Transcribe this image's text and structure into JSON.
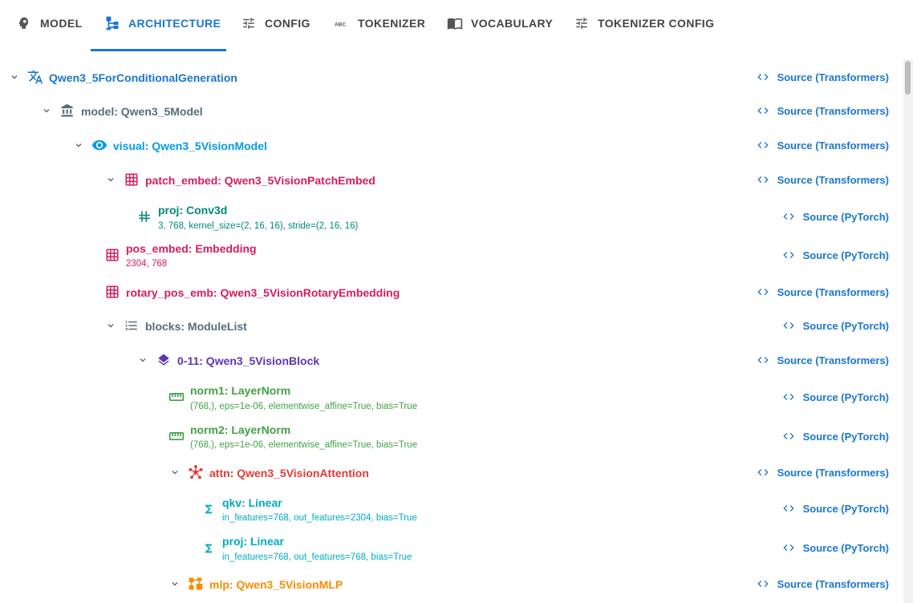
{
  "tabs": [
    {
      "label": "MODEL",
      "icon": "model-icon"
    },
    {
      "label": "ARCHITECTURE",
      "icon": "architecture-icon"
    },
    {
      "label": "CONFIG",
      "icon": "tune-icon"
    },
    {
      "label": "TOKENIZER",
      "icon": "abc-icon"
    },
    {
      "label": "VOCABULARY",
      "icon": "book-icon"
    },
    {
      "label": "TOKENIZER CONFIG",
      "icon": "tune-icon"
    }
  ],
  "active_tab": "ARCHITECTURE",
  "colors": {
    "accent": "#1976d2",
    "conditional_generation": "#1976d2",
    "model": "#546e7a",
    "visual": "#039be5",
    "patch_embed": "#d81b60",
    "conv": "#00897b",
    "module_list": "#546e7a",
    "block": "#5e35b1",
    "layer_norm": "#43a047",
    "attention": "#e53935",
    "linear": "#00acc1",
    "mlp": "#fb8c00"
  },
  "tree": [
    {
      "title": "Qwen3_5ForConditionalGeneration",
      "sub": "",
      "source": "Source (Transformers)",
      "icon": "translate-icon"
    },
    {
      "title": "model: Qwen3_5Model",
      "sub": "",
      "source": "Source (Transformers)",
      "icon": "bank-icon"
    },
    {
      "title": "visual: Qwen3_5VisionModel",
      "sub": "",
      "source": "Source (Transformers)",
      "icon": "eye-icon"
    },
    {
      "title": "patch_embed: Qwen3_5VisionPatchEmbed",
      "sub": "",
      "source": "Source (Transformers)",
      "icon": "grid-icon"
    },
    {
      "title": "proj: Conv3d",
      "sub": "3, 768, kernel_size=(2, 16, 16), stride=(2, 16, 16)",
      "source": "Source (PyTorch)",
      "icon": "hash-icon"
    },
    {
      "title": "pos_embed: Embedding",
      "sub": "2304, 768",
      "source": "Source (PyTorch)",
      "icon": "grid-icon"
    },
    {
      "title": "rotary_pos_emb: Qwen3_5VisionRotaryEmbedding",
      "sub": "",
      "source": "Source (Transformers)",
      "icon": "grid-icon"
    },
    {
      "title": "blocks: ModuleList",
      "sub": "",
      "source": "Source (PyTorch)",
      "icon": "list-icon"
    },
    {
      "title": "0-11: Qwen3_5VisionBlock",
      "sub": "",
      "source": "Source (Transformers)",
      "icon": "layers-icon"
    },
    {
      "title": "norm1: LayerNorm",
      "sub": "(768,), eps=1e-06, elementwise_affine=True, bias=True",
      "source": "Source (PyTorch)",
      "icon": "ruler-icon"
    },
    {
      "title": "norm2: LayerNorm",
      "sub": "(768,), eps=1e-06, elementwise_affine=True, bias=True",
      "source": "Source (PyTorch)",
      "icon": "ruler-icon"
    },
    {
      "title": "attn: Qwen3_5VisionAttention",
      "sub": "",
      "source": "Source (Transformers)",
      "icon": "hub-icon"
    },
    {
      "title": "qkv: Linear",
      "sub": "in_features=768, out_features=2304, bias=True",
      "source": "Source (PyTorch)",
      "icon": "sigma-icon"
    },
    {
      "title": "proj: Linear",
      "sub": "in_features=768, out_features=768, bias=True",
      "source": "Source (PyTorch)",
      "icon": "sigma-icon"
    },
    {
      "title": "mlp: Qwen3_5VisionMLP",
      "sub": "",
      "source": "Source (Transformers)",
      "icon": "mlp-icon"
    }
  ]
}
